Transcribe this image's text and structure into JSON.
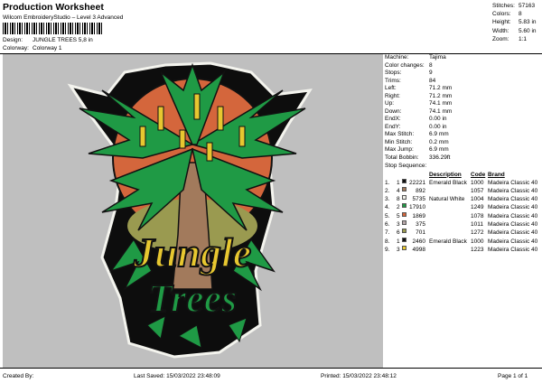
{
  "header": {
    "title": "Production Worksheet",
    "subtitle": "Wilcom EmbroideryStudio – Level 3 Advanced",
    "design_label": "Design:",
    "design_value": "JUNGLE TREES 5,8 in",
    "colorway_label": "Colorway:",
    "colorway_value": "Colorway 1"
  },
  "stats": [
    {
      "label": "Stitches:",
      "value": "57163"
    },
    {
      "label": "Colors:",
      "value": "8"
    },
    {
      "label": "Height:",
      "value": "5.83 in"
    },
    {
      "label": "Width:",
      "value": "5.60 in"
    },
    {
      "label": "Zoom:",
      "value": "1:1"
    }
  ],
  "machine_info": [
    {
      "label": "Machine:",
      "value": "Tajima"
    },
    {
      "label": "Color changes:",
      "value": "8"
    },
    {
      "label": "Stops:",
      "value": "9"
    },
    {
      "label": "Trims:",
      "value": "84"
    },
    {
      "label": "Left:",
      "value": "71.2 mm"
    },
    {
      "label": "Right:",
      "value": "71.2 mm"
    },
    {
      "label": "Up:",
      "value": "74.1 mm"
    },
    {
      "label": "Down:",
      "value": "74.1 mm"
    },
    {
      "label": "EndX:",
      "value": "0.00 in"
    },
    {
      "label": "EndY:",
      "value": "0.00 in"
    },
    {
      "label": "Max Stitch:",
      "value": "6.9 mm"
    },
    {
      "label": "Min Stitch:",
      "value": "0.2 mm"
    },
    {
      "label": "Max Jump:",
      "value": "6.9 mm"
    },
    {
      "label": "Total Bobbin:",
      "value": "336.29ft"
    }
  ],
  "stop_sequence": {
    "title": "Stop Sequence:",
    "columns": {
      "code_h": "Code",
      "brand_h": "Brand",
      "desc_h": "Description"
    },
    "rows": [
      {
        "seq": "1.",
        "stop": "1",
        "color": "#111111",
        "stitches": "22221",
        "desc": "Emerald Black",
        "code": "1000",
        "brand": "Madeira Classic 40"
      },
      {
        "seq": "2.",
        "stop": "4",
        "color": "#a27a5c",
        "stitches": "892",
        "desc": "",
        "code": "1057",
        "brand": "Madeira Classic 40"
      },
      {
        "seq": "3.",
        "stop": "8",
        "color": "#f2f2ea",
        "stitches": "5735",
        "desc": "Natural White",
        "code": "1004",
        "brand": "Madeira Classic 40"
      },
      {
        "seq": "4.",
        "stop": "2",
        "color": "#1f9a45",
        "stitches": "17910",
        "desc": "",
        "code": "1249",
        "brand": "Madeira Classic 40"
      },
      {
        "seq": "5.",
        "stop": "5",
        "color": "#d4663c",
        "stitches": "1869",
        "desc": "",
        "code": "1078",
        "brand": "Madeira Classic 40"
      },
      {
        "seq": "6.",
        "stop": "3",
        "color": "#b6a6a8",
        "stitches": "375",
        "desc": "",
        "code": "1011",
        "brand": "Madeira Classic 40"
      },
      {
        "seq": "7.",
        "stop": "6",
        "color": "#9a9a50",
        "stitches": "701",
        "desc": "",
        "code": "1272",
        "brand": "Madeira Classic 40"
      },
      {
        "seq": "8.",
        "stop": "1",
        "color": "#111111",
        "stitches": "2460",
        "desc": "Emerald Black",
        "code": "1000",
        "brand": "Madeira Classic 40"
      },
      {
        "seq": "9.",
        "stop": "3",
        "color": "#e7c730",
        "stitches": "4998",
        "desc": "",
        "code": "1223",
        "brand": "Madeira Classic 40"
      }
    ]
  },
  "design_text": {
    "line1": "Jungle",
    "line2": "Trees"
  },
  "footer": {
    "created_by": "Created By:",
    "last_saved": "Last Saved: 15/03/2022 23:48:09",
    "printed": "Printed: 15/03/2022 23:48:12",
    "page": "Page 1 of 1"
  }
}
